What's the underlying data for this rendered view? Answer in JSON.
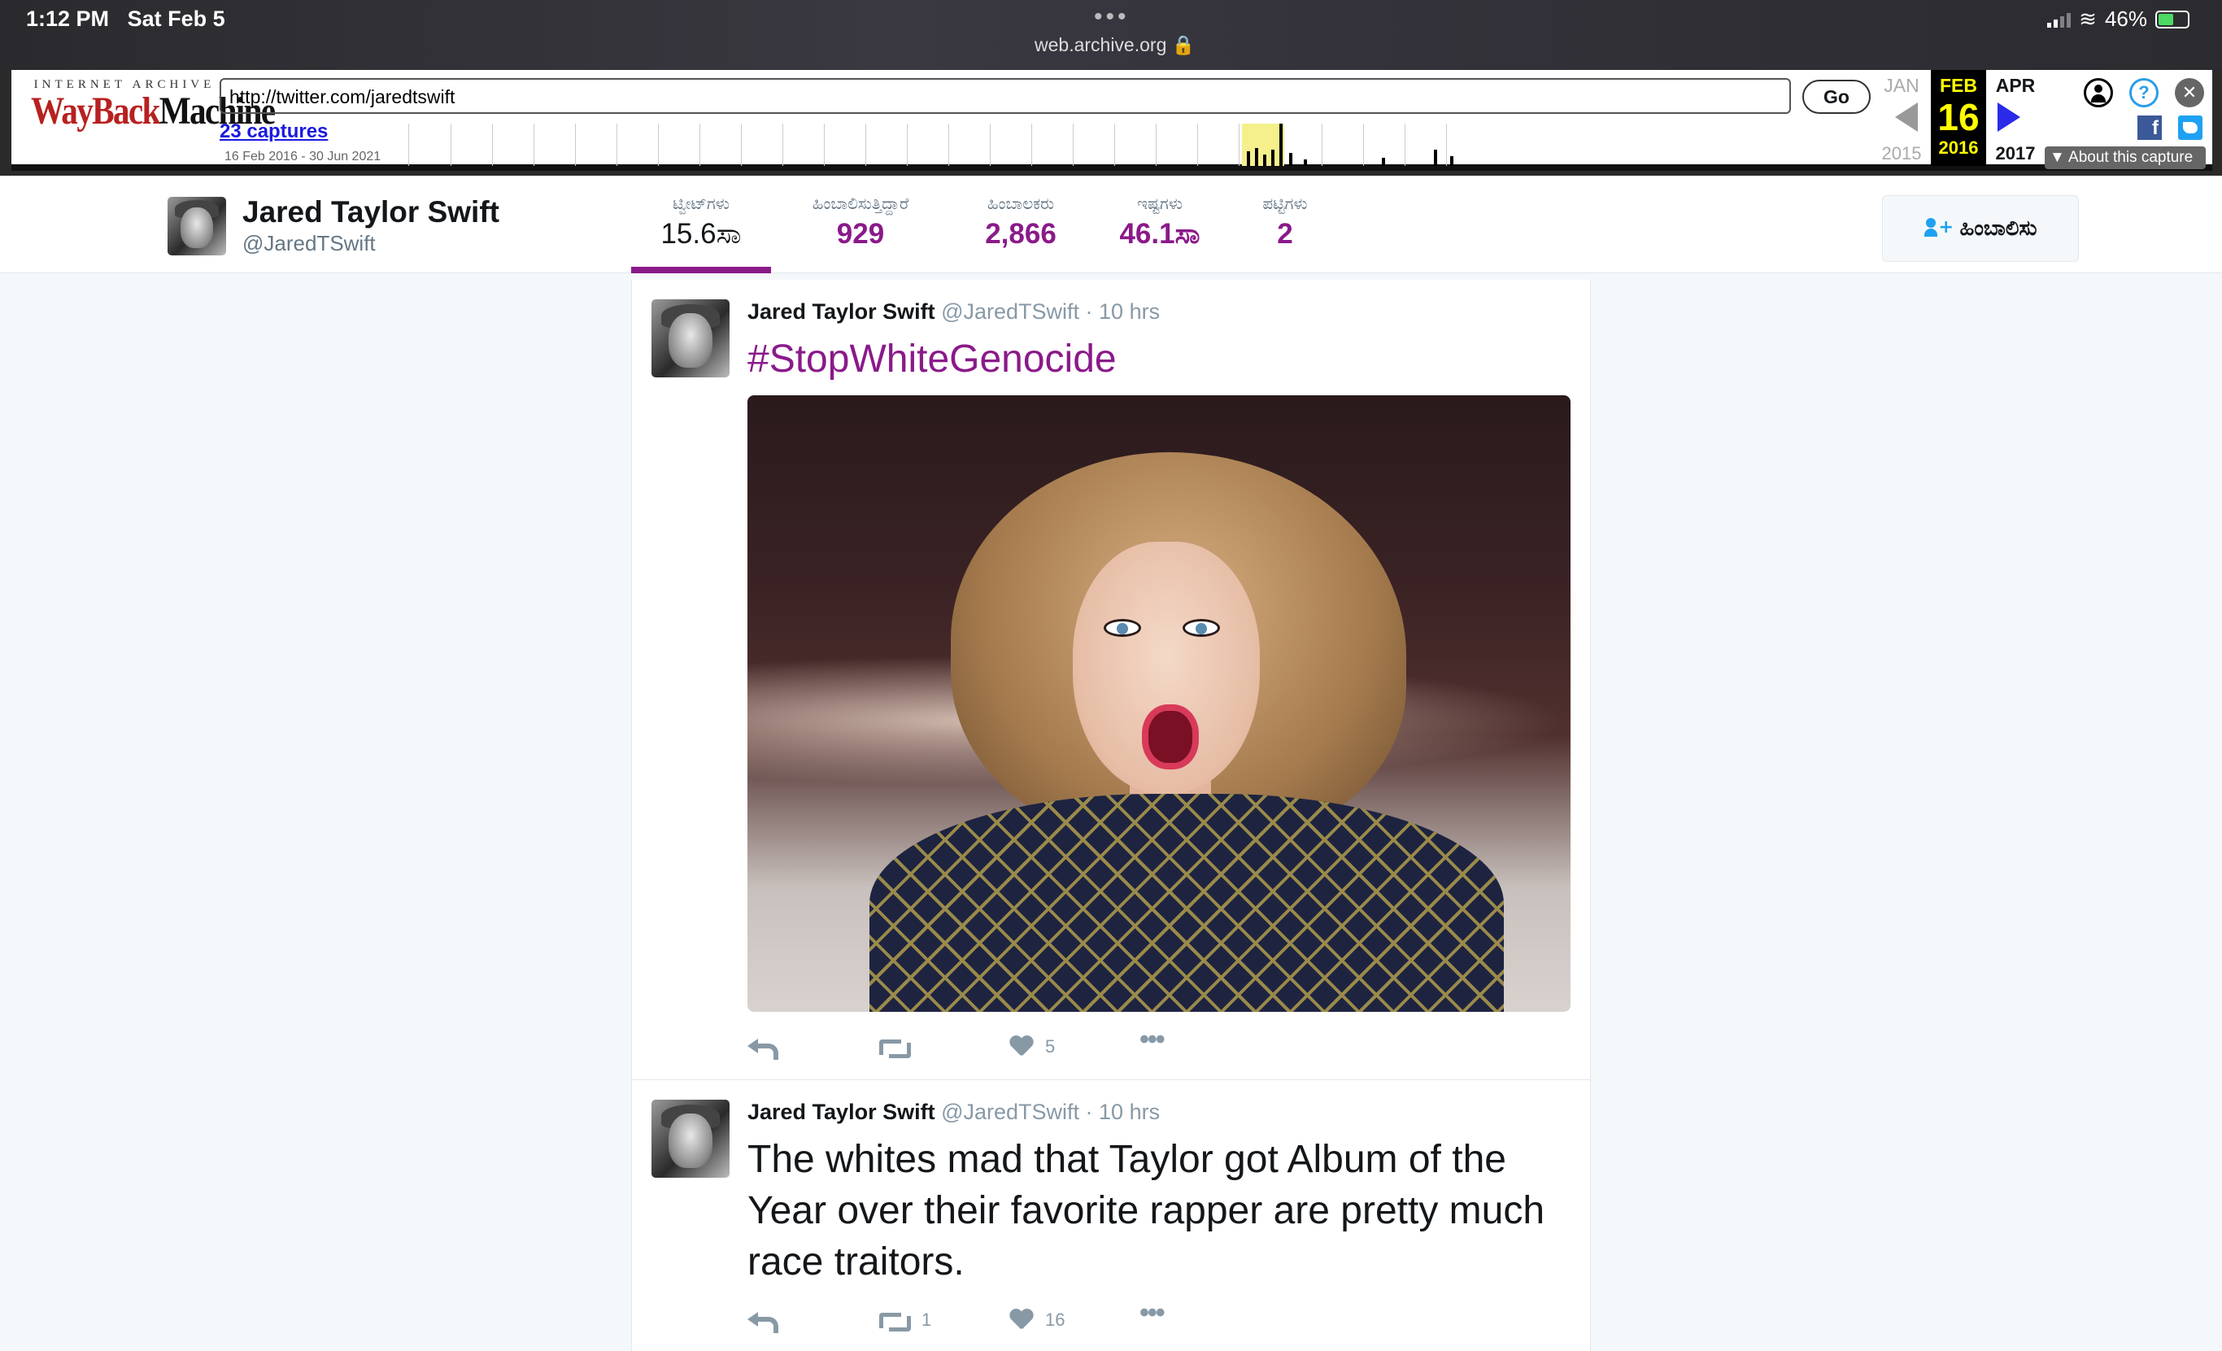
{
  "status_bar": {
    "time": "1:12 PM",
    "date": "Sat Feb 5",
    "dots": "•••",
    "url": "web.archive.org 🔒",
    "battery": "46%"
  },
  "wayback": {
    "logo_top": "INTERNET ARCHIVE",
    "logo_main_red": "WayBack",
    "logo_main_black": "Machine",
    "url_value": "http://twitter.com/jaredtswift",
    "go_label": "Go",
    "captures_label": "23 captures",
    "date_range": "16 Feb 2016 - 30 Jun 2021",
    "prev_month": "JAN",
    "current_month": "FEB",
    "next_month": "APR",
    "current_day": "16",
    "prev_year": "2015",
    "current_year": "2016",
    "next_year": "2017",
    "about_label": "▼ About this capture",
    "help_glyph": "?",
    "close_glyph": "✕",
    "facebook_glyph": "f"
  },
  "profile": {
    "name": "Jared Taylor Swift",
    "handle": "@JaredTSwift",
    "stats": [
      {
        "label": "ಟ್ವೀಟ್‌ಗಳು",
        "value": "15.6ಸಾ"
      },
      {
        "label": "ಹಿಂಬಾಲಿಸುತ್ತಿದ್ದಾರೆ",
        "value": "929"
      },
      {
        "label": "ಹಿಂಬಾಲಕರು",
        "value": "2,866"
      },
      {
        "label": "ಇಷ್ಟಗಳು",
        "value": "46.1ಸಾ"
      },
      {
        "label": "ಪಟ್ಟಿಗಳು",
        "value": "2"
      }
    ],
    "follow_label": "ಹಿಂಬಾಲಿಸು",
    "follow_plus": "+"
  },
  "tweets": [
    {
      "name": "Jared Taylor Swift",
      "meta": "@JaredTSwift · 10 hrs",
      "text": "#StopWhiteGenocide",
      "retweets": "",
      "likes": "5",
      "more": "•••"
    },
    {
      "name": "Jared Taylor Swift",
      "meta": "@JaredTSwift · 10 hrs",
      "text": "The whites mad that Taylor got Album of the Year over their favorite rapper are pretty much race traitors.",
      "retweets": "1",
      "likes": "16",
      "more": "•••"
    }
  ],
  "colors": {
    "accent": "#8a1a8a",
    "muted": "#8899a6",
    "wayback_red": "#b82020",
    "wayback_current": "#ffff00"
  }
}
